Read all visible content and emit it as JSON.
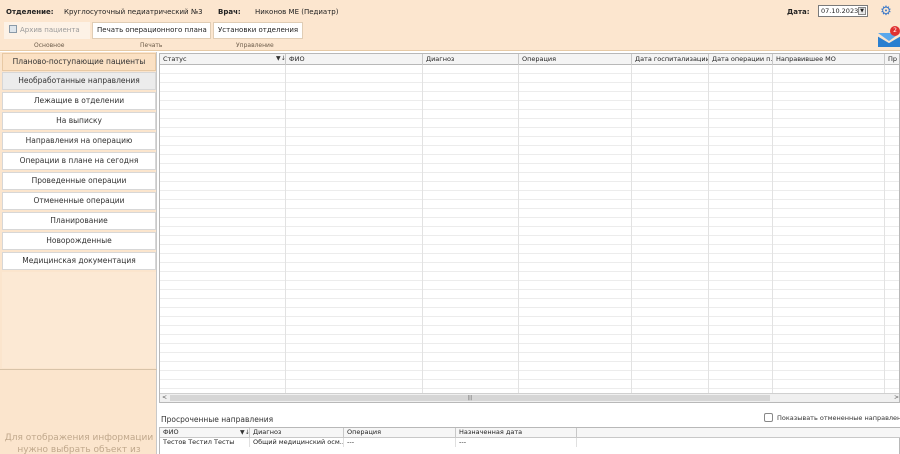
{
  "header": {
    "department_label": "Отделение:",
    "department_value": "Круглосуточный педиатрический №3",
    "doctor_label": "Врач:",
    "doctor_value": "Никонов МЕ (Педиатр)",
    "date_label": "Дата:",
    "date_value": "07.10.2023"
  },
  "toolbar": {
    "archive_label": "Архив пациента",
    "print_label": "Печать операционного плана",
    "settings_label": "Установки отделения",
    "group_main": "Основное",
    "group_print": "Печать",
    "group_manage": "Управление"
  },
  "notifications": {
    "count": "2"
  },
  "sidebar": {
    "items": [
      {
        "label": "Планово-поступающие пациенты"
      },
      {
        "label": "Необработанные направления"
      },
      {
        "label": "Лежащие в отделении"
      },
      {
        "label": "На выписку"
      },
      {
        "label": "Направления на операцию"
      },
      {
        "label": "Операции в плане на сегодня"
      },
      {
        "label": "Проведенные операции"
      },
      {
        "label": "Отмененные операции"
      },
      {
        "label": "Планирование"
      },
      {
        "label": "Новорожденные"
      },
      {
        "label": "Медицинская документация"
      }
    ],
    "hint": "Для отображения информации нужно выбрать объект из списка"
  },
  "main_grid": {
    "columns": [
      "Статус",
      "ФИО",
      "Диагноз",
      "Операция",
      "Дата госпитализации",
      "Дата операции п...",
      "Направившее МО",
      "Пр"
    ],
    "rows": []
  },
  "overdue": {
    "title": "Просроченные направления",
    "show_cancelled_label": "Показывать отмененные направления",
    "show_cancelled_checked": false,
    "columns": [
      "ФИО",
      "Диагноз",
      "Операция",
      "Назначенная дата"
    ],
    "rows": [
      {
        "fio": "Тестов Тестил Тесты",
        "diagnosis": "Общий медицинский осм...",
        "operation": "---",
        "date": "---"
      }
    ]
  }
}
